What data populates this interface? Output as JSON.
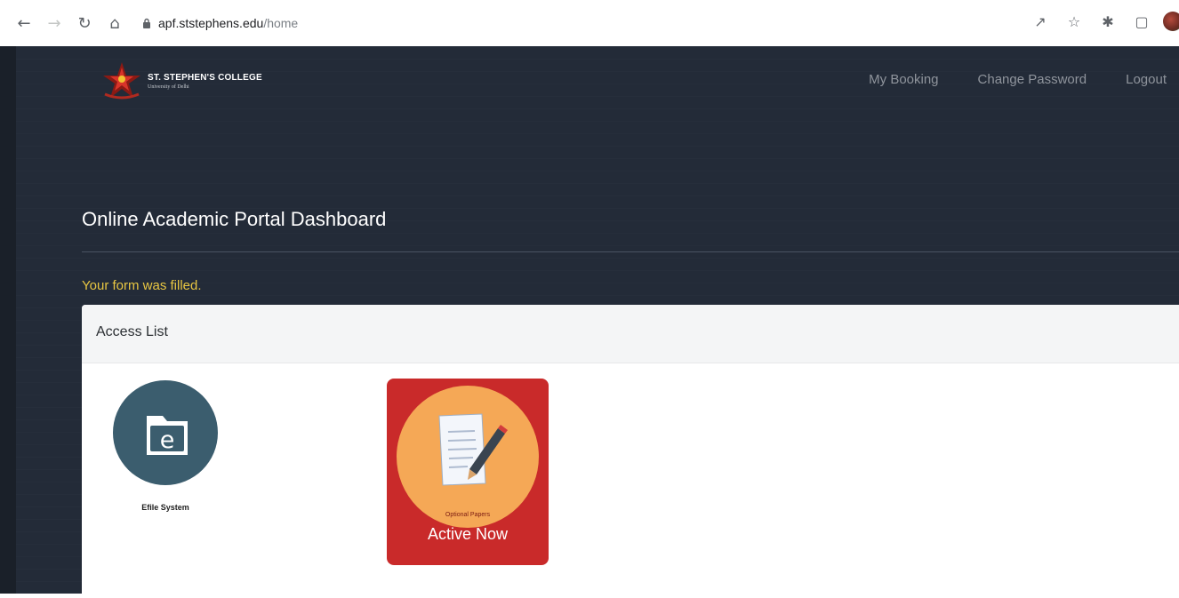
{
  "browser": {
    "url_host": "apf.ststephens.edu",
    "url_path": "/home",
    "icons": [
      "back-arrow-icon",
      "forward-arrow-icon",
      "reload-icon",
      "home-icon",
      "lock-icon",
      "share-icon",
      "star-icon",
      "extensions-icon",
      "side-panel-icon",
      "profile-avatar"
    ]
  },
  "header": {
    "college_name": "ST. STEPHEN'S COLLEGE",
    "college_sub": "University of Delhi"
  },
  "nav": {
    "items": [
      {
        "label": "My Booking"
      },
      {
        "label": "Change Password"
      },
      {
        "label": "Logout"
      }
    ]
  },
  "dashboard": {
    "title": "Online Academic Portal Dashboard",
    "message": "Your form was filled."
  },
  "access_list": {
    "title": "Access List",
    "tiles": [
      {
        "label": "Efile System",
        "icon": "efile-folder-icon"
      },
      {
        "label": "Optional Papers",
        "status": "Active Now",
        "icon": "document-pen-icon"
      }
    ]
  },
  "colors": {
    "page_bg": "#232b38",
    "message": "#e8c642",
    "efile": "#3b5d6e",
    "active_tile": "#c92a2a",
    "active_circle": "#f5a856"
  }
}
